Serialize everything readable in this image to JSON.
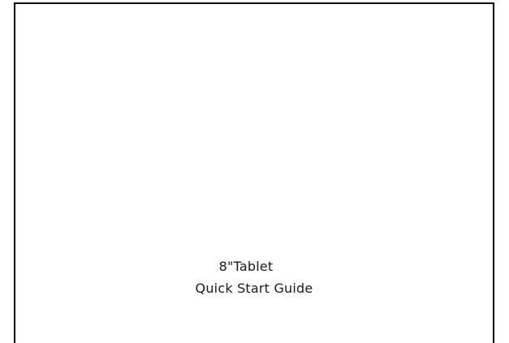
{
  "cover": {
    "title_line1": "8\"Tablet",
    "title_line2": "Quick Start Guide"
  }
}
